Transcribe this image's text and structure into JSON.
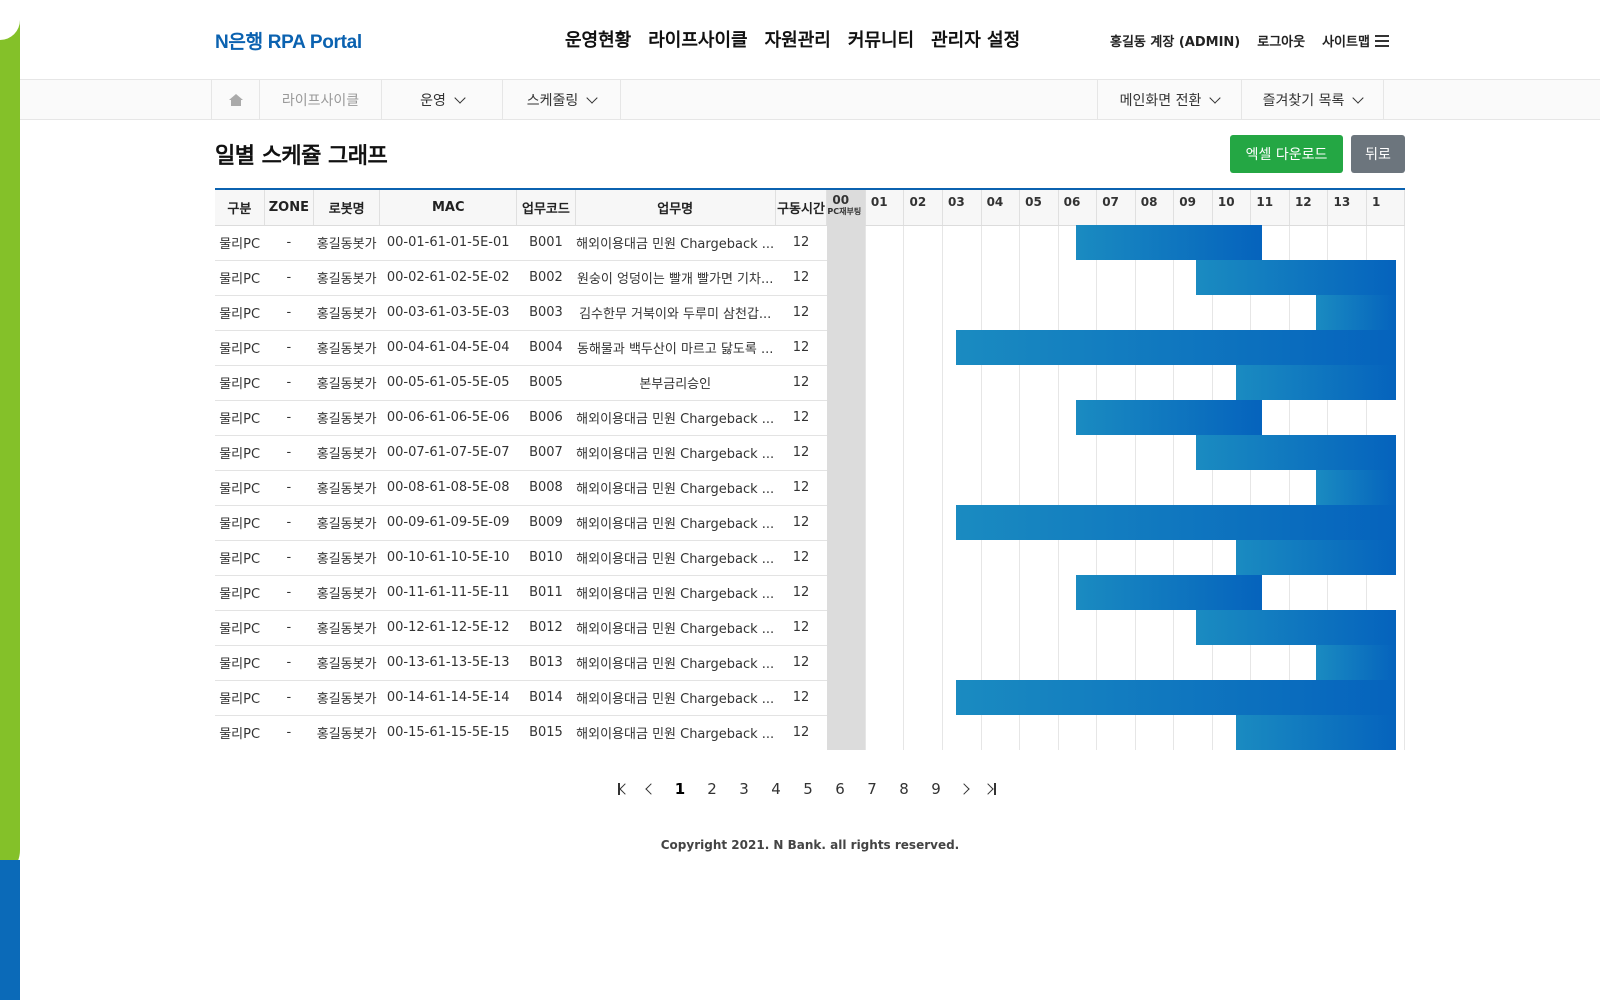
{
  "brand": {
    "logo": "N은행 RPA Portal",
    "accent": "#0b62b0",
    "green": "#84c129"
  },
  "gnb": [
    "운영현황",
    "라이프사이클",
    "자원관리",
    "커뮤니티",
    "관리자 설정"
  ],
  "util": {
    "user": "홍길동 계장 (ADMIN)",
    "logout": "로그아웃",
    "sitemap": "사이트맵"
  },
  "subnav": {
    "breadcrumb": "라이프사이클",
    "menu1": "운영",
    "menu2": "스케줄링",
    "switch_main": "메인화면 전환",
    "favorites": "즐겨찾기 목록"
  },
  "page": {
    "title": "일별 스케쥴 그래프",
    "excel_button": "엑셀 다운로드",
    "back_button": "뒤로"
  },
  "table": {
    "columns": [
      "구분",
      "ZONE",
      "로봇명",
      "MAC",
      "업무코드",
      "업무명",
      "구동시간"
    ],
    "hours": [
      "00",
      "01",
      "02",
      "03",
      "04",
      "05",
      "06",
      "07",
      "08",
      "09",
      "10",
      "11",
      "12",
      "13",
      "1"
    ],
    "hour0_sub": "PC재부팅",
    "rows": [
      {
        "type": "물리PC",
        "zone": "-",
        "robot": "홍길동봇가",
        "mac": "00-01-61-01-5E-01",
        "code": "B001",
        "task": "해외이용대금 민원 Chargeback ...",
        "run": "12",
        "start": 6,
        "end": 10.65
      },
      {
        "type": "물리PC",
        "zone": "-",
        "robot": "홍길동봇가",
        "mac": "00-02-61-02-5E-02",
        "code": "B002",
        "task": "원숭이 엉덩이는 빨개 빨가면 기차...",
        "run": "12",
        "start": 9,
        "end": 14
      },
      {
        "type": "물리PC",
        "zone": "-",
        "robot": "홍길동봇가",
        "mac": "00-03-61-03-5E-03",
        "code": "B003",
        "task": "김수한무 거북이와 두루미 삼천갑...",
        "run": "12",
        "start": 12,
        "end": 14
      },
      {
        "type": "물리PC",
        "zone": "-",
        "robot": "홍길동봇가",
        "mac": "00-04-61-04-5E-04",
        "code": "B004",
        "task": "동해물과 백두산이 마르고 닳도록 ...",
        "run": "12",
        "start": 3,
        "end": 14
      },
      {
        "type": "물리PC",
        "zone": "-",
        "robot": "홍길동봇가",
        "mac": "00-05-61-05-5E-05",
        "code": "B005",
        "task": "본부금리승인",
        "run": "12",
        "start": 10,
        "end": 14
      },
      {
        "type": "물리PC",
        "zone": "-",
        "robot": "홍길동봇가",
        "mac": "00-06-61-06-5E-06",
        "code": "B006",
        "task": "해외이용대금 민원 Chargeback ...",
        "run": "12",
        "start": 6,
        "end": 10.65
      },
      {
        "type": "물리PC",
        "zone": "-",
        "robot": "홍길동봇가",
        "mac": "00-07-61-07-5E-07",
        "code": "B007",
        "task": "해외이용대금 민원 Chargeback ...",
        "run": "12",
        "start": 9,
        "end": 14
      },
      {
        "type": "물리PC",
        "zone": "-",
        "robot": "홍길동봇가",
        "mac": "00-08-61-08-5E-08",
        "code": "B008",
        "task": "해외이용대금 민원 Chargeback ...",
        "run": "12",
        "start": 12,
        "end": 14
      },
      {
        "type": "물리PC",
        "zone": "-",
        "robot": "홍길동봇가",
        "mac": "00-09-61-09-5E-09",
        "code": "B009",
        "task": "해외이용대금 민원 Chargeback ...",
        "run": "12",
        "start": 3,
        "end": 14
      },
      {
        "type": "물리PC",
        "zone": "-",
        "robot": "홍길동봇가",
        "mac": "00-10-61-10-5E-10",
        "code": "B010",
        "task": "해외이용대금 민원 Chargeback ...",
        "run": "12",
        "start": 10,
        "end": 14
      },
      {
        "type": "물리PC",
        "zone": "-",
        "robot": "홍길동봇가",
        "mac": "00-11-61-11-5E-11",
        "code": "B011",
        "task": "해외이용대금 민원 Chargeback ...",
        "run": "12",
        "start": 6,
        "end": 10.65
      },
      {
        "type": "물리PC",
        "zone": "-",
        "robot": "홍길동봇가",
        "mac": "00-12-61-12-5E-12",
        "code": "B012",
        "task": "해외이용대금 민원 Chargeback ...",
        "run": "12",
        "start": 9,
        "end": 14
      },
      {
        "type": "물리PC",
        "zone": "-",
        "robot": "홍길동봇가",
        "mac": "00-13-61-13-5E-13",
        "code": "B013",
        "task": "해외이용대금 민원 Chargeback ...",
        "run": "12",
        "start": 12,
        "end": 14
      },
      {
        "type": "물리PC",
        "zone": "-",
        "robot": "홍길동봇가",
        "mac": "00-14-61-14-5E-14",
        "code": "B014",
        "task": "해외이용대금 민원 Chargeback ...",
        "run": "12",
        "start": 3,
        "end": 14
      },
      {
        "type": "물리PC",
        "zone": "-",
        "robot": "홍길동봇가",
        "mac": "00-15-61-15-5E-15",
        "code": "B015",
        "task": "해외이용대금 민원 Chargeback ...",
        "run": "12",
        "start": 10,
        "end": 14
      }
    ]
  },
  "pagination": {
    "pages": [
      "1",
      "2",
      "3",
      "4",
      "5",
      "6",
      "7",
      "8",
      "9"
    ],
    "current": "1"
  },
  "footer": {
    "copyright": "Copyright 2021. N Bank. all rights reserved."
  }
}
